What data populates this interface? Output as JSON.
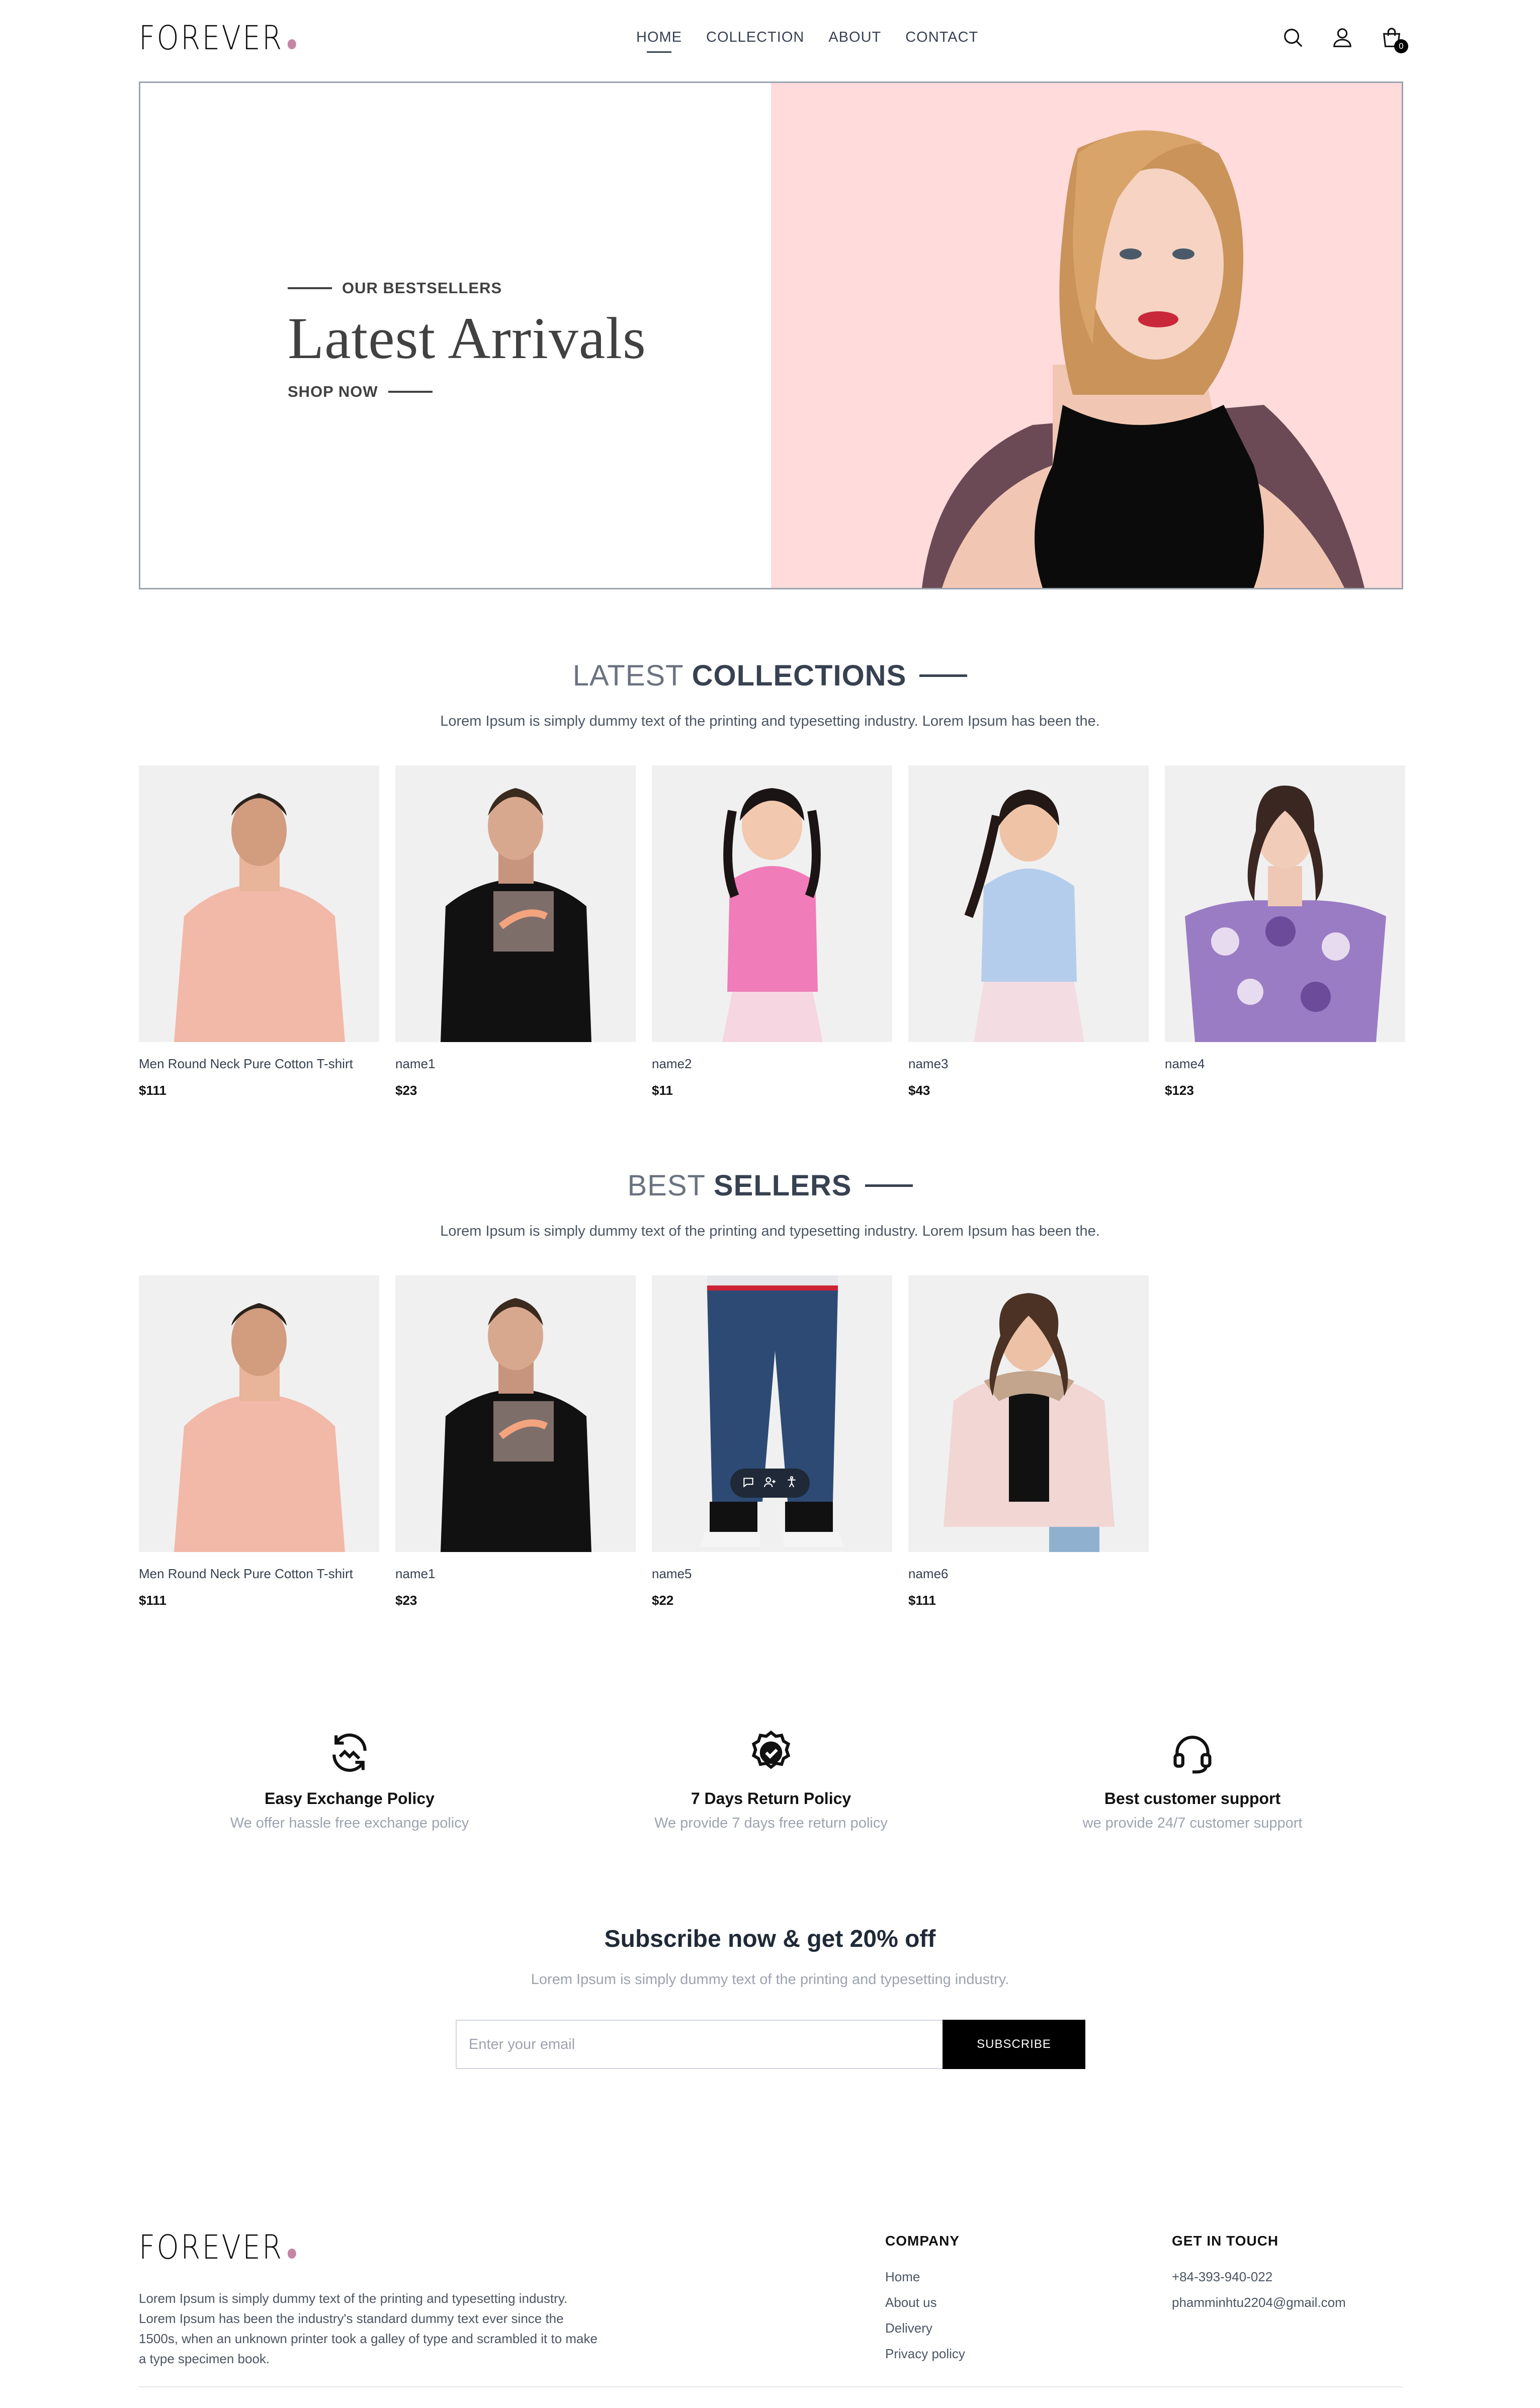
{
  "brand": {
    "name": "FOREVER",
    "accent": "#c586a5"
  },
  "nav": {
    "items": [
      {
        "label": "HOME",
        "active": true
      },
      {
        "label": "COLLECTION",
        "active": false
      },
      {
        "label": "ABOUT",
        "active": false
      },
      {
        "label": "CONTACT",
        "active": false
      }
    ],
    "icons": [
      "search-icon",
      "user-icon",
      "cart-icon"
    ],
    "cart_count": "0"
  },
  "hero": {
    "tag": "OUR BESTSELLERS",
    "title": "Latest Arrivals",
    "cta": "SHOP NOW",
    "bg_color": "#ffdbdb"
  },
  "latest": {
    "title_light": "LATEST",
    "title_bold": "COLLECTIONS",
    "subtitle": "Lorem Ipsum is simply dummy text of the printing and typesetting industry. Lorem Ipsum has been the.",
    "products": [
      {
        "name": "Men Round Neck Pure Cotton T-shirt",
        "price": "$111"
      },
      {
        "name": "name1",
        "price": "$23"
      },
      {
        "name": "name2",
        "price": "$11"
      },
      {
        "name": "name3",
        "price": "$43"
      },
      {
        "name": "name4",
        "price": "$123"
      }
    ]
  },
  "bestsellers": {
    "title_light": "BEST",
    "title_bold": "SELLERS",
    "subtitle": "Lorem Ipsum is simply dummy text of the printing and typesetting industry. Lorem Ipsum has been the.",
    "products": [
      {
        "name": "Men Round Neck Pure Cotton T-shirt",
        "price": "$111"
      },
      {
        "name": "name1",
        "price": "$23"
      },
      {
        "name": "name5",
        "price": "$22"
      },
      {
        "name": "name6",
        "price": "$111"
      }
    ]
  },
  "policies": [
    {
      "icon": "exchange-icon",
      "title": "Easy Exchange Policy",
      "desc": "We offer hassle free exchange policy"
    },
    {
      "icon": "quality-badge-icon",
      "title": "7 Days Return Policy",
      "desc": "We provide 7 days free return policy"
    },
    {
      "icon": "headset-icon",
      "title": "Best customer support",
      "desc": "we provide 24/7 customer support"
    }
  ],
  "subscribe": {
    "title": "Subscribe now & get 20% off",
    "desc": "Lorem Ipsum is simply dummy text of the printing and typesetting industry.",
    "placeholder": "Enter your email",
    "button": "SUBSCRIBE"
  },
  "footer": {
    "about": "Lorem Ipsum is simply dummy text of the printing and typesetting industry. Lorem Ipsum has been the industry's standard dummy text ever since the 1500s, when an unknown printer took a galley of type and scrambled it to make a type specimen book.",
    "company_title": "COMPANY",
    "company_links": [
      "Home",
      "About us",
      "Delivery",
      "Privacy policy"
    ],
    "contact_title": "GET IN TOUCH",
    "phone": "+84-393-940-022",
    "email": "phamminhtu2204@gmail.com"
  }
}
